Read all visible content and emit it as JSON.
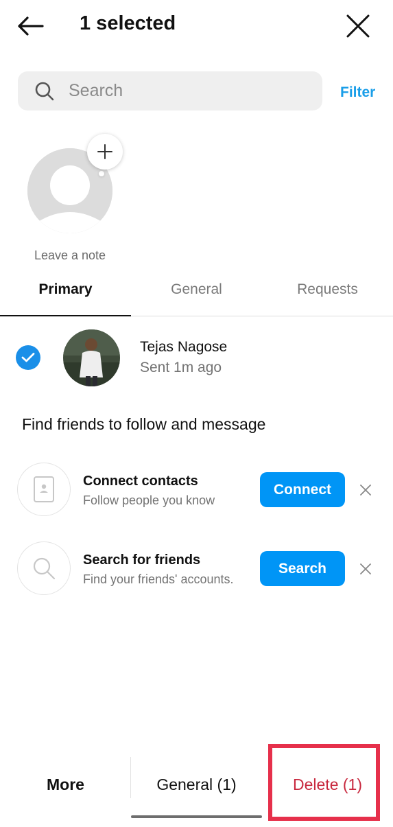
{
  "header": {
    "title": "1 selected",
    "back_icon": "arrow-left-icon",
    "close_icon": "close-icon"
  },
  "search": {
    "placeholder": "Search",
    "value": "",
    "filter_label": "Filter"
  },
  "note": {
    "label": "Leave a note",
    "add_icon": "plus-icon"
  },
  "tabs": [
    {
      "label": "Primary",
      "active": true
    },
    {
      "label": "General",
      "active": false
    },
    {
      "label": "Requests",
      "active": false
    }
  ],
  "threads": [
    {
      "name": "Tejas Nagose",
      "status": "Sent 1m ago",
      "selected": true
    }
  ],
  "find_friends": {
    "heading": "Find friends to follow and message",
    "suggestions": [
      {
        "title": "Connect contacts",
        "subtitle": "Follow people you know",
        "button": "Connect",
        "icon": "contact-book-icon"
      },
      {
        "title": "Search for friends",
        "subtitle": "Find your friends' accounts.",
        "button": "Search",
        "icon": "search-icon"
      }
    ]
  },
  "bottom_bar": {
    "more": "More",
    "general": "General (1)",
    "delete": "Delete (1)"
  },
  "colors": {
    "accent": "#0095f6",
    "link": "#1a9ee8",
    "delete": "#c8283e",
    "highlight": "#e6304b"
  }
}
